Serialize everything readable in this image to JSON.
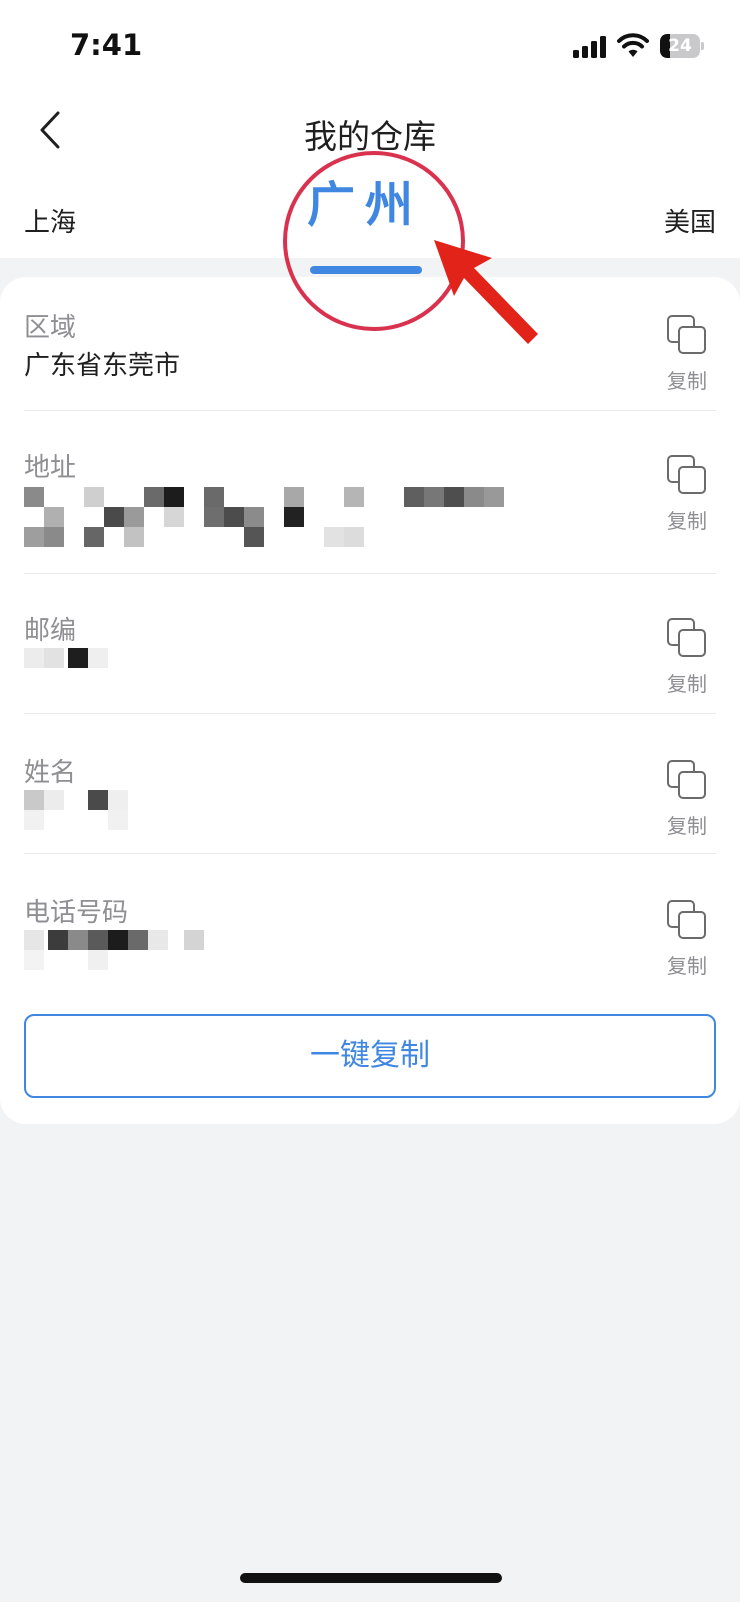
{
  "status_bar": {
    "time": "7:41",
    "battery": "24",
    "battery_level": 0.24
  },
  "nav": {
    "title": "我的仓库"
  },
  "tabs": {
    "left": "上海",
    "active": "广州",
    "right": "美国"
  },
  "fields": [
    {
      "label": "区域",
      "value": "广东省东莞市",
      "copy_label": "复制"
    },
    {
      "label": "地址",
      "value": "",
      "copy_label": "复制"
    },
    {
      "label": "邮编",
      "value": "",
      "copy_label": "复制"
    },
    {
      "label": "姓名",
      "value": "",
      "copy_label": "复制"
    },
    {
      "label": "电话号码",
      "value": "",
      "copy_label": "复制"
    }
  ],
  "actions": {
    "copy_all": "一键复制"
  },
  "colors": {
    "accent": "#3f87e0",
    "annotation": "#d9324f"
  }
}
